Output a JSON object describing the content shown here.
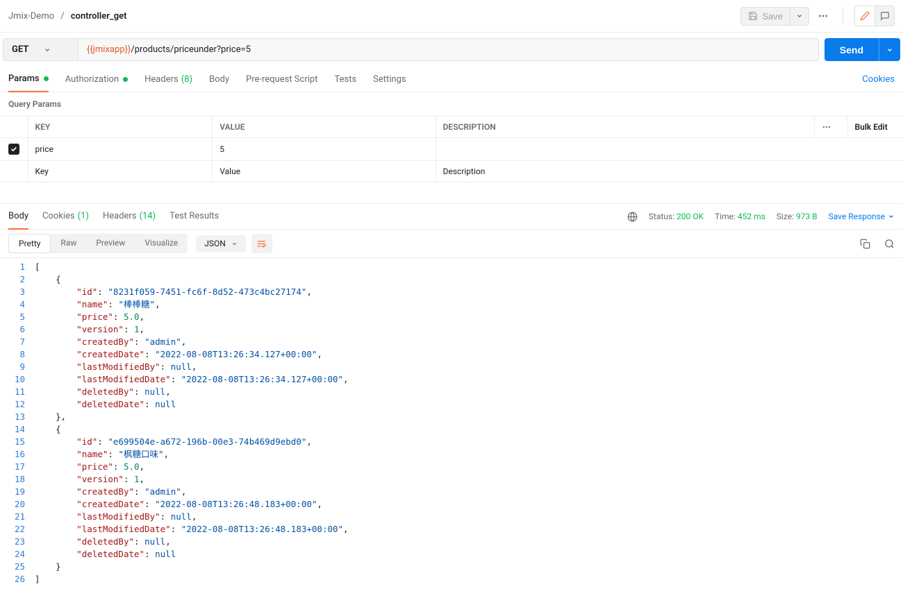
{
  "breadcrumb": {
    "parent": "Jmix-Demo",
    "sep": "/",
    "current": "controller_get"
  },
  "header": {
    "save": "Save"
  },
  "request": {
    "method": "GET",
    "url_var": "{{jmixapp}}",
    "url_path": "/products/priceunder?price=5",
    "send": "Send"
  },
  "reqTabs": {
    "params": "Params",
    "auth": "Authorization",
    "headers": "Headers",
    "headers_count": "(8)",
    "body": "Body",
    "prerequest": "Pre-request Script",
    "tests": "Tests",
    "settings": "Settings",
    "cookies": "Cookies"
  },
  "querySection": "Query Params",
  "paramsTable": {
    "h_key": "KEY",
    "h_value": "VALUE",
    "h_desc": "DESCRIPTION",
    "bulk": "Bulk Edit",
    "rows": [
      {
        "key": "price",
        "value": "5",
        "desc": ""
      }
    ],
    "ph_key": "Key",
    "ph_value": "Value",
    "ph_desc": "Description"
  },
  "respTabs": {
    "body": "Body",
    "cookies": "Cookies",
    "cookies_count": "(1)",
    "headers": "Headers",
    "headers_count": "(14)",
    "testresults": "Test Results"
  },
  "respMeta": {
    "status_label": "Status:",
    "status_val": "200 OK",
    "time_label": "Time:",
    "time_val": "452 ms",
    "size_label": "Size:",
    "size_val": "973 B",
    "saveresp": "Save Response"
  },
  "bodyToolbar": {
    "pretty": "Pretty",
    "raw": "Raw",
    "preview": "Preview",
    "visualize": "Visualize",
    "format": "JSON"
  },
  "json_lines": [
    [
      {
        "t": "punc",
        "v": "["
      }
    ],
    [
      {
        "t": "indent",
        "v": 1
      },
      {
        "t": "punc",
        "v": "{"
      }
    ],
    [
      {
        "t": "indent",
        "v": 2
      },
      {
        "t": "key",
        "v": "\"id\""
      },
      {
        "t": "punc",
        "v": ": "
      },
      {
        "t": "str",
        "v": "\"8231f059-7451-fc6f-8d52-473c4bc27174\""
      },
      {
        "t": "punc",
        "v": ","
      }
    ],
    [
      {
        "t": "indent",
        "v": 2
      },
      {
        "t": "key",
        "v": "\"name\""
      },
      {
        "t": "punc",
        "v": ": "
      },
      {
        "t": "str",
        "v": "\"棒棒糖\""
      },
      {
        "t": "punc",
        "v": ","
      }
    ],
    [
      {
        "t": "indent",
        "v": 2
      },
      {
        "t": "key",
        "v": "\"price\""
      },
      {
        "t": "punc",
        "v": ": "
      },
      {
        "t": "num",
        "v": "5.0"
      },
      {
        "t": "punc",
        "v": ","
      }
    ],
    [
      {
        "t": "indent",
        "v": 2
      },
      {
        "t": "key",
        "v": "\"version\""
      },
      {
        "t": "punc",
        "v": ": "
      },
      {
        "t": "num",
        "v": "1"
      },
      {
        "t": "punc",
        "v": ","
      }
    ],
    [
      {
        "t": "indent",
        "v": 2
      },
      {
        "t": "key",
        "v": "\"createdBy\""
      },
      {
        "t": "punc",
        "v": ": "
      },
      {
        "t": "str",
        "v": "\"admin\""
      },
      {
        "t": "punc",
        "v": ","
      }
    ],
    [
      {
        "t": "indent",
        "v": 2
      },
      {
        "t": "key",
        "v": "\"createdDate\""
      },
      {
        "t": "punc",
        "v": ": "
      },
      {
        "t": "str",
        "v": "\"2022-08-08T13:26:34.127+00:00\""
      },
      {
        "t": "punc",
        "v": ","
      }
    ],
    [
      {
        "t": "indent",
        "v": 2
      },
      {
        "t": "key",
        "v": "\"lastModifiedBy\""
      },
      {
        "t": "punc",
        "v": ": "
      },
      {
        "t": "null",
        "v": "null"
      },
      {
        "t": "punc",
        "v": ","
      }
    ],
    [
      {
        "t": "indent",
        "v": 2
      },
      {
        "t": "key",
        "v": "\"lastModifiedDate\""
      },
      {
        "t": "punc",
        "v": ": "
      },
      {
        "t": "str",
        "v": "\"2022-08-08T13:26:34.127+00:00\""
      },
      {
        "t": "punc",
        "v": ","
      }
    ],
    [
      {
        "t": "indent",
        "v": 2
      },
      {
        "t": "key",
        "v": "\"deletedBy\""
      },
      {
        "t": "punc",
        "v": ": "
      },
      {
        "t": "null",
        "v": "null"
      },
      {
        "t": "punc",
        "v": ","
      }
    ],
    [
      {
        "t": "indent",
        "v": 2
      },
      {
        "t": "key",
        "v": "\"deletedDate\""
      },
      {
        "t": "punc",
        "v": ": "
      },
      {
        "t": "null",
        "v": "null"
      }
    ],
    [
      {
        "t": "indent",
        "v": 1
      },
      {
        "t": "punc",
        "v": "},"
      }
    ],
    [
      {
        "t": "indent",
        "v": 1
      },
      {
        "t": "punc",
        "v": "{"
      }
    ],
    [
      {
        "t": "indent",
        "v": 2
      },
      {
        "t": "key",
        "v": "\"id\""
      },
      {
        "t": "punc",
        "v": ": "
      },
      {
        "t": "str",
        "v": "\"e699504e-a672-196b-00e3-74b469d9ebd0\""
      },
      {
        "t": "punc",
        "v": ","
      }
    ],
    [
      {
        "t": "indent",
        "v": 2
      },
      {
        "t": "key",
        "v": "\"name\""
      },
      {
        "t": "punc",
        "v": ": "
      },
      {
        "t": "str",
        "v": "\"枫糖口味\""
      },
      {
        "t": "punc",
        "v": ","
      }
    ],
    [
      {
        "t": "indent",
        "v": 2
      },
      {
        "t": "key",
        "v": "\"price\""
      },
      {
        "t": "punc",
        "v": ": "
      },
      {
        "t": "num",
        "v": "5.0"
      },
      {
        "t": "punc",
        "v": ","
      }
    ],
    [
      {
        "t": "indent",
        "v": 2
      },
      {
        "t": "key",
        "v": "\"version\""
      },
      {
        "t": "punc",
        "v": ": "
      },
      {
        "t": "num",
        "v": "1"
      },
      {
        "t": "punc",
        "v": ","
      }
    ],
    [
      {
        "t": "indent",
        "v": 2
      },
      {
        "t": "key",
        "v": "\"createdBy\""
      },
      {
        "t": "punc",
        "v": ": "
      },
      {
        "t": "str",
        "v": "\"admin\""
      },
      {
        "t": "punc",
        "v": ","
      }
    ],
    [
      {
        "t": "indent",
        "v": 2
      },
      {
        "t": "key",
        "v": "\"createdDate\""
      },
      {
        "t": "punc",
        "v": ": "
      },
      {
        "t": "str",
        "v": "\"2022-08-08T13:26:48.183+00:00\""
      },
      {
        "t": "punc",
        "v": ","
      }
    ],
    [
      {
        "t": "indent",
        "v": 2
      },
      {
        "t": "key",
        "v": "\"lastModifiedBy\""
      },
      {
        "t": "punc",
        "v": ": "
      },
      {
        "t": "null",
        "v": "null"
      },
      {
        "t": "punc",
        "v": ","
      }
    ],
    [
      {
        "t": "indent",
        "v": 2
      },
      {
        "t": "key",
        "v": "\"lastModifiedDate\""
      },
      {
        "t": "punc",
        "v": ": "
      },
      {
        "t": "str",
        "v": "\"2022-08-08T13:26:48.183+00:00\""
      },
      {
        "t": "punc",
        "v": ","
      }
    ],
    [
      {
        "t": "indent",
        "v": 2
      },
      {
        "t": "key",
        "v": "\"deletedBy\""
      },
      {
        "t": "punc",
        "v": ": "
      },
      {
        "t": "null",
        "v": "null"
      },
      {
        "t": "punc",
        "v": ","
      }
    ],
    [
      {
        "t": "indent",
        "v": 2
      },
      {
        "t": "key",
        "v": "\"deletedDate\""
      },
      {
        "t": "punc",
        "v": ": "
      },
      {
        "t": "null",
        "v": "null"
      }
    ],
    [
      {
        "t": "indent",
        "v": 1
      },
      {
        "t": "punc",
        "v": "}"
      }
    ],
    [
      {
        "t": "punc",
        "v": "]"
      }
    ]
  ]
}
